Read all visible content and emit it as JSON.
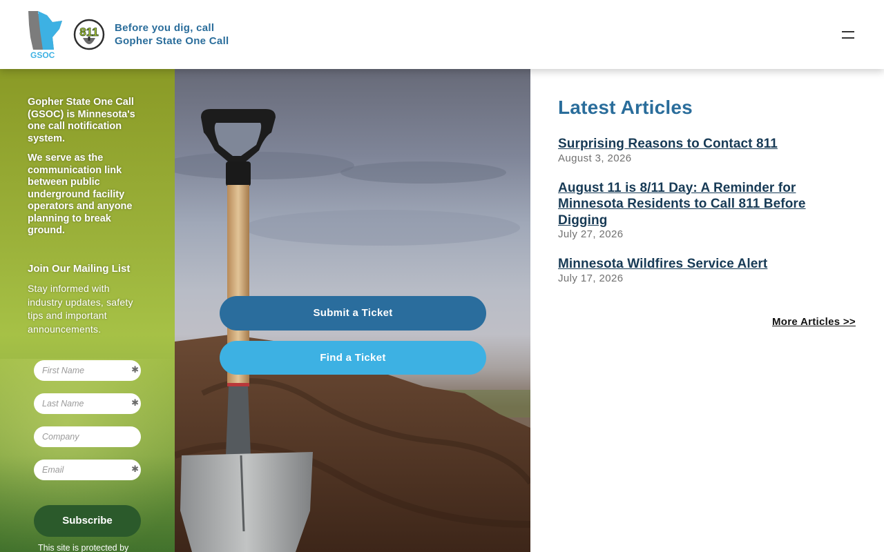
{
  "header": {
    "logo_gsoc_text": "GSOC",
    "logo_811_text": "811",
    "tagline_line1": "Before you dig, call",
    "tagline_line2": "Gopher State One Call",
    "menu_icon": "hamburger-menu-icon"
  },
  "sidebar": {
    "intro_p1": "Gopher State One Call (GSOC) is Minnesota's one call notification system.",
    "intro_p2": "We serve as the communication link between public underground facility operators and anyone planning to break ground.",
    "mailing_title": "Join Our Mailing List",
    "mailing_desc": "Stay informed with industry updates, safety tips and important announcements.",
    "fields": {
      "first_name": "First Name",
      "last_name": "Last Name",
      "company": "Company",
      "email": "Email"
    },
    "required_mark": "✱",
    "subscribe_label": "Subscribe",
    "protected_text": "This site is protected by"
  },
  "hero": {
    "submit_label": "Submit a Ticket",
    "find_label": "Find a Ticket"
  },
  "articles": {
    "title": "Latest Articles",
    "items": [
      {
        "title": "Surprising Reasons to Contact 811",
        "date": "August 3, 2026"
      },
      {
        "title": "August 11 is 8/11 Day: A Reminder for Minnesota Residents to Call 811 Before Digging",
        "date": "July 27, 2026"
      },
      {
        "title": "Minnesota Wildfires Service Alert",
        "date": "July 17, 2026"
      }
    ],
    "more_label": "More Articles >>"
  },
  "colors": {
    "brand_blue": "#2a6d9b",
    "light_blue": "#3db1e3",
    "subscribe_green": "#2b5a2b",
    "sidebar_green": "#9bb13a"
  }
}
